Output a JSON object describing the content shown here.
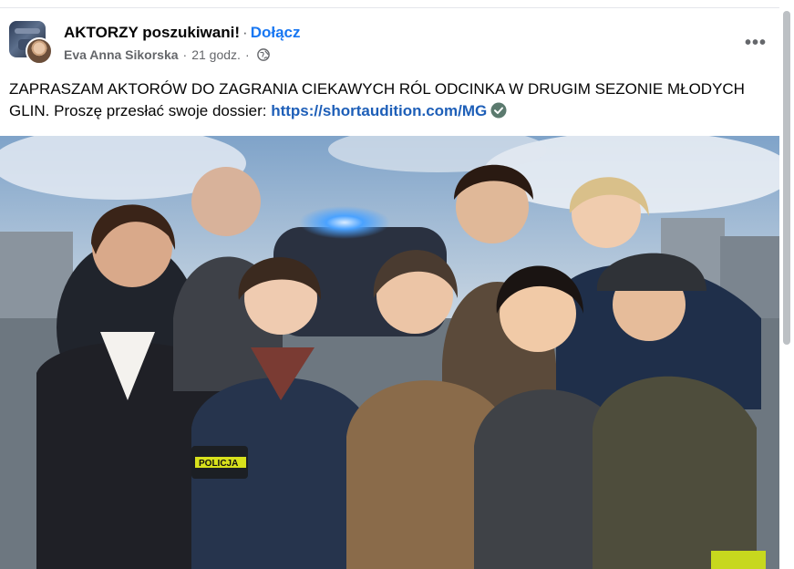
{
  "post": {
    "group_name": "AKTORZY poszukiwani!",
    "separator": "·",
    "join_label": "Dołącz",
    "author": "Eva Anna Sikorska",
    "time": "21 godz.",
    "privacy_icon": "globe-icon",
    "more_icon": "more-options-icon",
    "more_label": "•••",
    "text_main": "ZAPRASZAM AKTORÓW  DO ZAGRANIA CIEKAWYCH RÓL ODCINKA W DRUGIM SEZONIE MŁODYCH GLIN.  Proszę przesłać swoje dossier: ",
    "link_text": "https://shortaudition.com/MG",
    "verified_icon": "check-circle-icon",
    "image": {
      "badge_text": "POLICJA"
    }
  },
  "colors": {
    "link": "#1e5fb8",
    "join": "#1877f2",
    "meta": "#65676b",
    "text": "#050505"
  }
}
